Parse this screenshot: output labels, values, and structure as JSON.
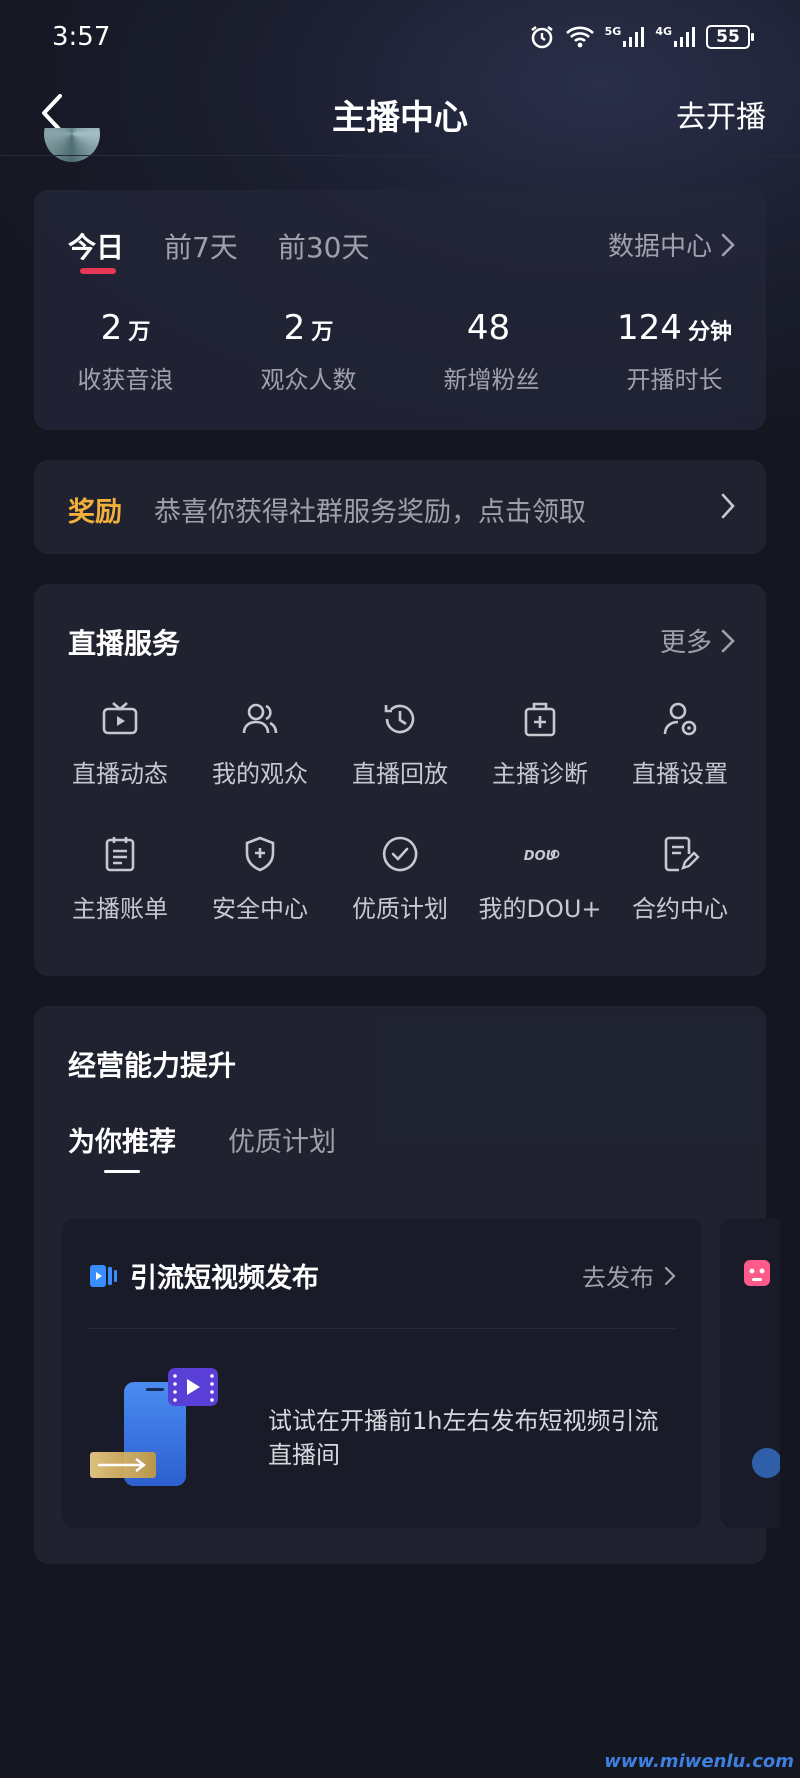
{
  "status_bar": {
    "time": "3:57",
    "battery": "55",
    "signal_a": "5G",
    "signal_b": "4G"
  },
  "nav": {
    "title": "主播中心",
    "action": "去开播"
  },
  "stats": {
    "tabs": [
      "今日",
      "前7天",
      "前30天"
    ],
    "data_center": "数据中心",
    "items": [
      {
        "value": "2",
        "unit": "万",
        "label": "收获音浪"
      },
      {
        "value": "2",
        "unit": "万",
        "label": "观众人数"
      },
      {
        "value": "48",
        "unit": "",
        "label": "新增粉丝"
      },
      {
        "value": "124",
        "unit": "分钟",
        "label": "开播时长"
      }
    ]
  },
  "reward": {
    "tag": "奖励",
    "text": "恭喜你获得社群服务奖励，点击领取"
  },
  "live_service": {
    "title": "直播服务",
    "more": "更多",
    "items": [
      {
        "label": "直播动态",
        "icon": "tv-play-icon"
      },
      {
        "label": "我的观众",
        "icon": "users-icon"
      },
      {
        "label": "直播回放",
        "icon": "history-icon"
      },
      {
        "label": "主播诊断",
        "icon": "medical-kit-icon"
      },
      {
        "label": "直播设置",
        "icon": "user-settings-icon"
      },
      {
        "label": "主播账单",
        "icon": "clipboard-icon"
      },
      {
        "label": "安全中心",
        "icon": "shield-icon"
      },
      {
        "label": "优质计划",
        "icon": "check-badge-icon"
      },
      {
        "label": "我的DOU+",
        "icon": "dou-plus-icon"
      },
      {
        "label": "合约中心",
        "icon": "contract-edit-icon"
      }
    ]
  },
  "business": {
    "title": "经营能力提升",
    "tabs": [
      "为你推荐",
      "优质计划"
    ],
    "promo": {
      "title": "引流短视频发布",
      "action": "去发布",
      "description": "试试在开播前1h左右发布短视频引流直播间"
    }
  },
  "watermark": "www.miwenlu.com",
  "colors": {
    "accent": "#e63855",
    "reward": "#f2b03a",
    "background": "#141620",
    "card": "#222534"
  }
}
